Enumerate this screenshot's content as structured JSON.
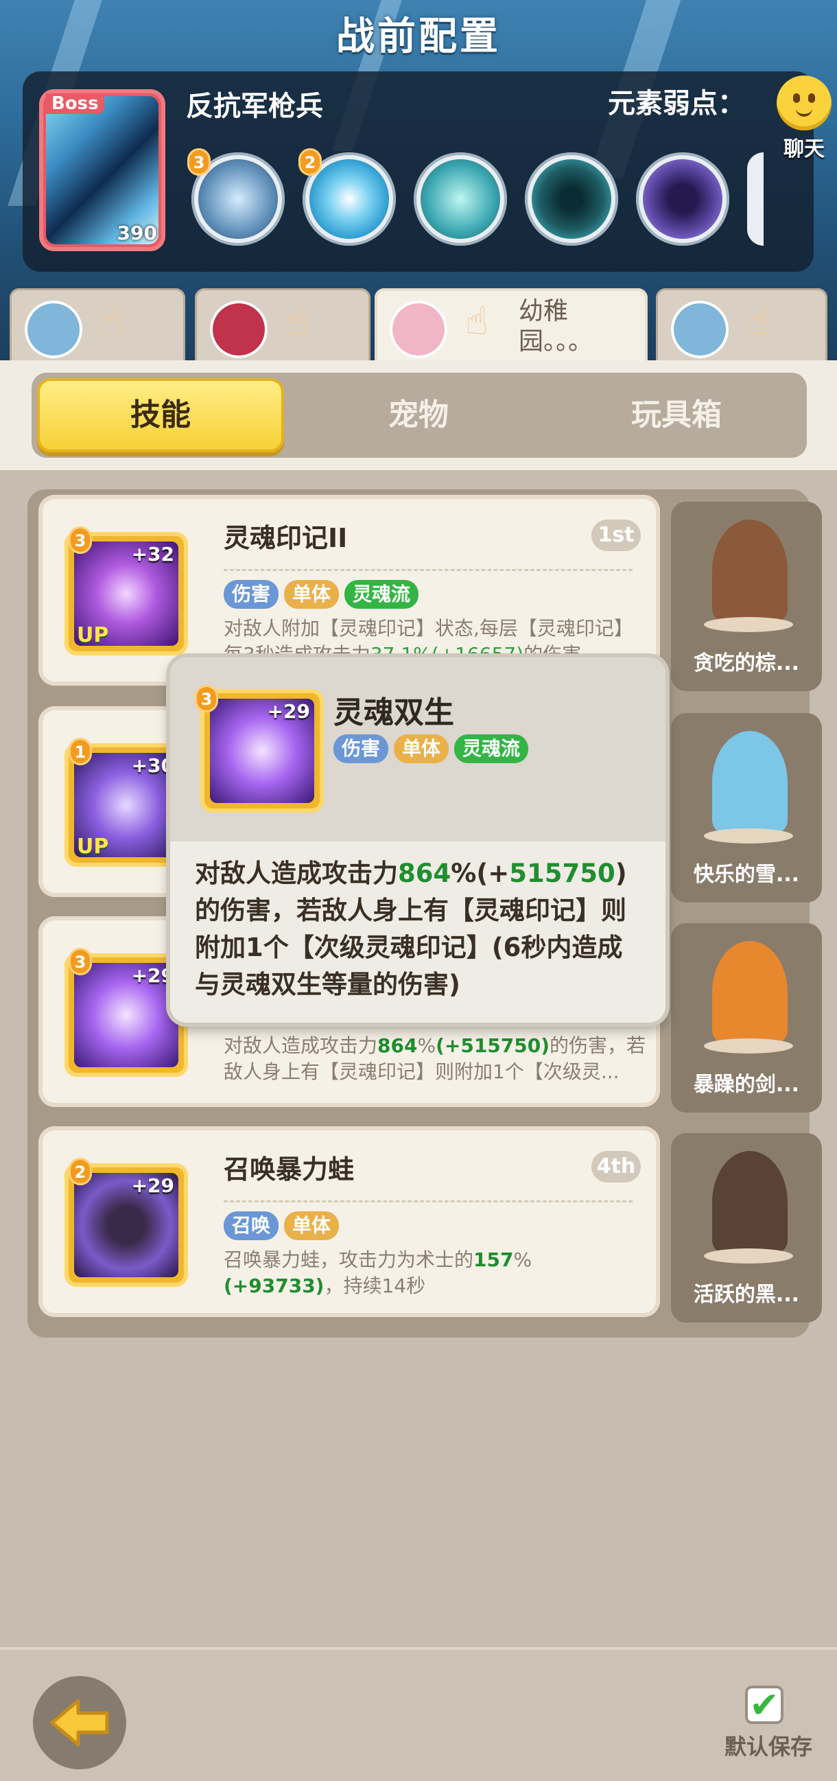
{
  "header": {
    "title": "战前配置",
    "boss": {
      "tag": "Boss",
      "name": "反抗军枪兵",
      "level": "390"
    },
    "weakness_label": "元素弱点：",
    "chat_label": "聊天",
    "boss_skills": [
      {
        "level": "3",
        "color": "#5f8fb8",
        "icon": "ice-spear-icon"
      },
      {
        "level": "2",
        "color": "#39a6d6",
        "icon": "eye-icon"
      },
      {
        "level": "",
        "color": "#3aa6b0",
        "icon": "totem-icon"
      },
      {
        "level": "",
        "color": "#1f5b63",
        "icon": "shadow-warrior-icon"
      },
      {
        "level": "",
        "color": "#5f4aa8",
        "icon": "monster-icon"
      }
    ]
  },
  "teams": [
    {
      "name": ""
    },
    {
      "name": ""
    },
    {
      "name": "幼稚园。。。"
    },
    {
      "name": ""
    }
  ],
  "tabs": [
    {
      "label": "技能"
    },
    {
      "label": "宠物"
    },
    {
      "label": "玩具箱"
    }
  ],
  "skills": [
    {
      "name": "灵魂印记II",
      "rank": "1st",
      "level": "3",
      "plus": "+32",
      "up": "UP",
      "tags": [
        "伤害",
        "单体",
        "灵魂流"
      ],
      "desc_a": "对敌人附加【灵魂印记】状态,每层【灵魂印记】每3秒造成攻击力",
      "desc_pct": "37.1%",
      "desc_bonus": "(+16657)",
      "desc_b": "的伤害"
    },
    {
      "name": "",
      "rank": "",
      "level": "1",
      "plus": "+30",
      "up": "UP",
      "tags": [],
      "desc_a": "",
      "desc_pct": "",
      "desc_bonus": "",
      "desc_b": ""
    },
    {
      "name": "",
      "rank": "",
      "level": "3",
      "plus": "+29",
      "up": "",
      "tags": [],
      "desc_a": "对敌人造成攻击力",
      "desc_pct": "864",
      "desc_pct_unit": "%",
      "desc_bonus": "(+515750)",
      "desc_b": "的伤害，若敌人身上有【灵魂印记】则附加1个【次级灵...",
      "desc_c": "..."
    },
    {
      "name": "召唤暴力蛙",
      "rank": "4th",
      "level": "2",
      "plus": "+29",
      "up": "",
      "tags": [
        "召唤",
        "单体"
      ],
      "desc_a": "召唤暴力蛙，攻击力为术士的",
      "desc_pct": "157",
      "desc_pct_unit": "%",
      "desc_bonus": "(+93733)",
      "desc_b": "，持续14秒"
    }
  ],
  "pets": [
    {
      "name": "贪吃的棕...",
      "color": "#8a5a3a"
    },
    {
      "name": "快乐的雪...",
      "color": "#7cc6e8"
    },
    {
      "name": "暴躁的剑...",
      "color": "#e8882e"
    },
    {
      "name": "活跃的黑...",
      "color": "#5a4236"
    }
  ],
  "popup": {
    "name": "灵魂双生",
    "level": "3",
    "plus": "+29",
    "tags": [
      "伤害",
      "单体",
      "灵魂流"
    ],
    "desc_1": "对敌人造成攻击力",
    "pct": "864",
    "pct_unit": "%",
    "bonus_open": "(+",
    "bonus": "515750",
    "bonus_close": ")",
    "desc_2": "的伤害，若敌人身上有【灵魂印记】则附加1个【次级灵魂印记】(6秒内造成与灵魂双生等量的伤害)"
  },
  "bottom": {
    "save_label": "默认保存",
    "save_checked": "✔"
  },
  "colors": {
    "accent": "#f7cf33",
    "damage_tag": "#6b97d6",
    "single_tag": "#eab04a",
    "soul_tag": "#33b545",
    "highlight": "#2ea13f"
  }
}
